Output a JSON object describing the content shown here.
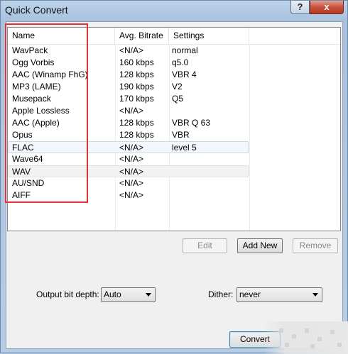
{
  "window": {
    "title": "Quick Convert",
    "help_glyph": "?",
    "close_glyph": "x"
  },
  "list": {
    "columns": [
      "Name",
      "Avg. Bitrate",
      "Settings"
    ],
    "rows": [
      {
        "name": "WavPack",
        "bitrate": "<N/A>",
        "settings": "normal"
      },
      {
        "name": "Ogg Vorbis",
        "bitrate": "160 kbps",
        "settings": "q5.0"
      },
      {
        "name": "AAC (Winamp FhG)",
        "bitrate": "128 kbps",
        "settings": "VBR 4"
      },
      {
        "name": "MP3 (LAME)",
        "bitrate": "190 kbps",
        "settings": "V2"
      },
      {
        "name": "Musepack",
        "bitrate": "170 kbps",
        "settings": "Q5"
      },
      {
        "name": "Apple Lossless",
        "bitrate": "<N/A>",
        "settings": ""
      },
      {
        "name": "AAC (Apple)",
        "bitrate": "128 kbps",
        "settings": "VBR Q 63"
      },
      {
        "name": "Opus",
        "bitrate": "128 kbps",
        "settings": "VBR"
      },
      {
        "name": "FLAC",
        "bitrate": "<N/A>",
        "settings": "level 5"
      },
      {
        "name": "Wave64",
        "bitrate": "<N/A>",
        "settings": ""
      },
      {
        "name": "WAV",
        "bitrate": "<N/A>",
        "settings": ""
      },
      {
        "name": "AU/SND",
        "bitrate": "<N/A>",
        "settings": ""
      },
      {
        "name": "AIFF",
        "bitrate": "<N/A>",
        "settings": ""
      }
    ],
    "selected_row": "FLAC",
    "hover_row": "WAV"
  },
  "buttons": {
    "edit": "Edit",
    "add_new": "Add New",
    "remove": "Remove",
    "convert": "Convert"
  },
  "output_bit_depth": {
    "label": "Output bit depth:",
    "value": "Auto"
  },
  "dither": {
    "label": "Dither:",
    "value": "never"
  }
}
